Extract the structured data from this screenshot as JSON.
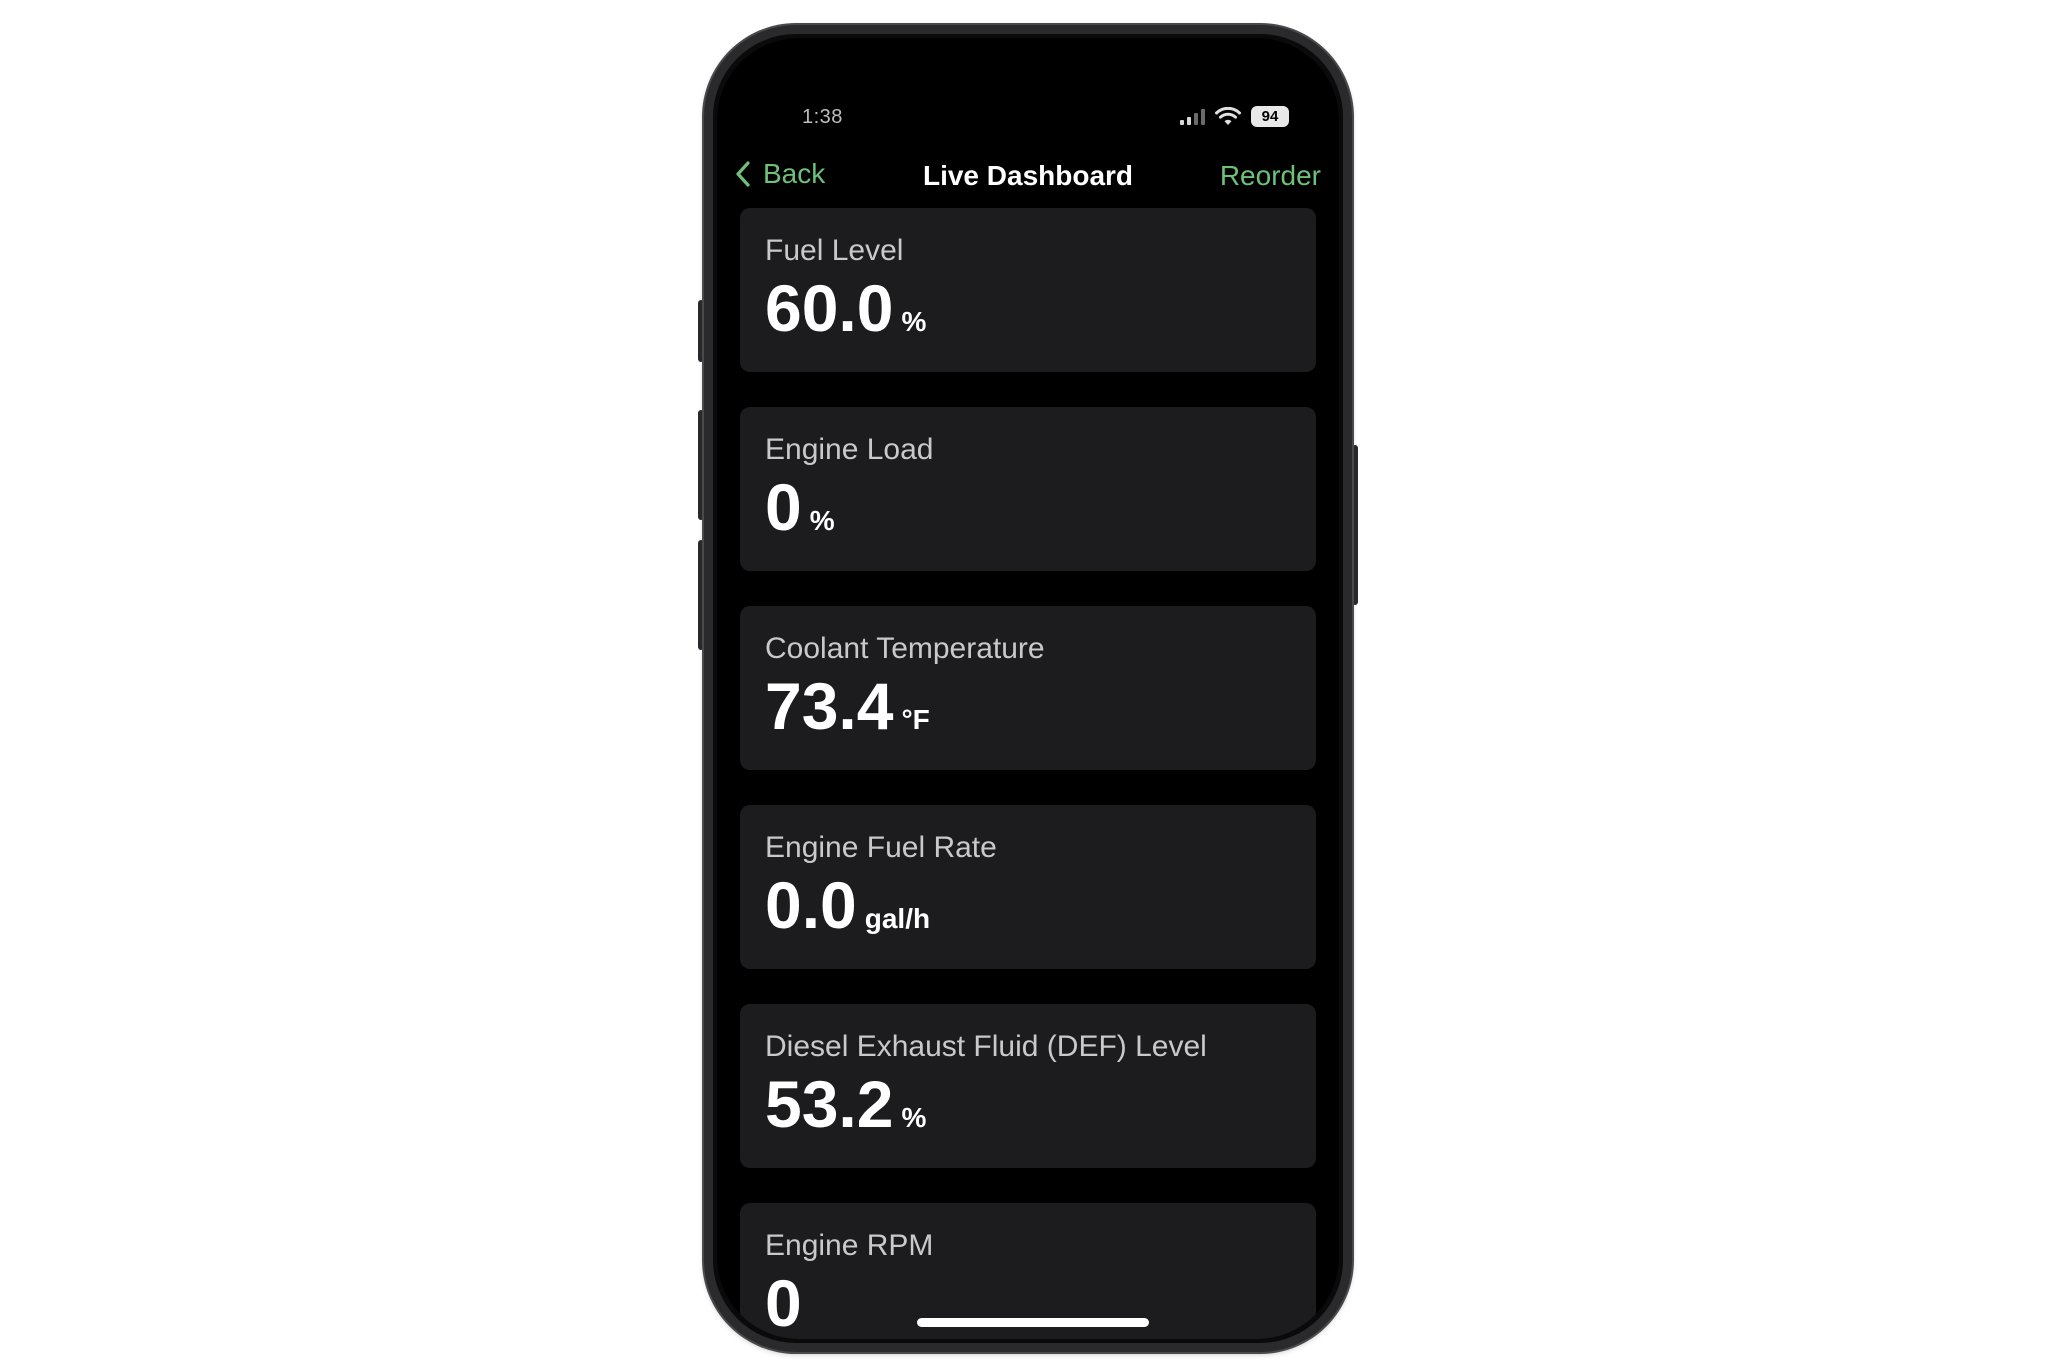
{
  "status_bar": {
    "time": "1:38",
    "battery": "94"
  },
  "nav": {
    "back_label": "Back",
    "title": "Live Dashboard",
    "reorder_label": "Reorder"
  },
  "colors": {
    "accent": "#6fc07a",
    "card_background": "#1c1c1e",
    "screen_background": "#000000"
  },
  "cards": [
    {
      "label": "Fuel Level",
      "value": "60.0",
      "unit": "%"
    },
    {
      "label": "Engine Load",
      "value": "0",
      "unit": "%"
    },
    {
      "label": "Coolant Temperature",
      "value": "73.4",
      "unit": "°F"
    },
    {
      "label": "Engine Fuel Rate",
      "value": "0.0",
      "unit": "gal/h"
    },
    {
      "label": "Diesel Exhaust Fluid (DEF) Level",
      "value": "53.2",
      "unit": "%"
    },
    {
      "label": "Engine RPM",
      "value": "0",
      "unit": ""
    }
  ]
}
